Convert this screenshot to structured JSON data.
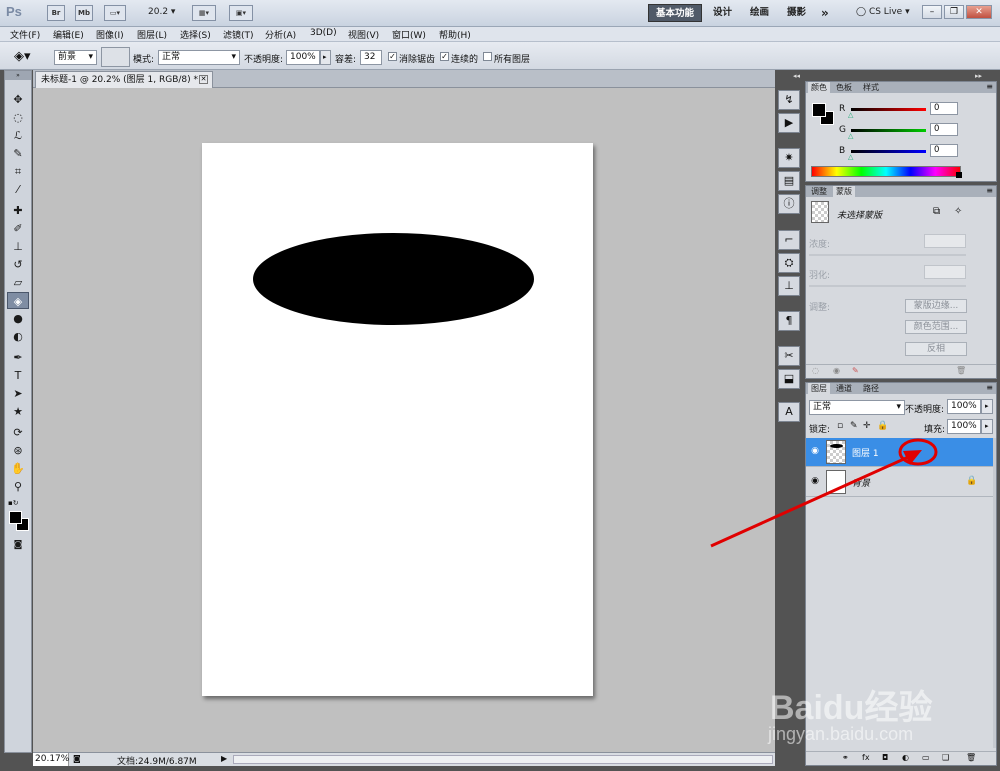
{
  "appbar": {
    "logo": "Ps",
    "bridge_label": "Br",
    "minibridge_label": "Mb",
    "zoom": "20.2",
    "workspaces": [
      "基本功能",
      "设计",
      "绘画",
      "摄影"
    ],
    "more": "»",
    "cslive": "CS Live"
  },
  "menu": [
    "文件(F)",
    "编辑(E)",
    "图像(I)",
    "图层(L)",
    "选择(S)",
    "滤镜(T)",
    "分析(A)",
    "3D(D)",
    "视图(V)",
    "窗口(W)",
    "帮助(H)"
  ],
  "options": {
    "fill_source": "前景",
    "mode_label": "模式:",
    "mode_value": "正常",
    "opacity_label": "不透明度:",
    "opacity_value": "100%",
    "tolerance_label": "容差:",
    "tolerance_value": "32",
    "antialias_label": "消除锯齿",
    "contiguous_label": "连续的",
    "all_layers_label": "所有图层"
  },
  "document": {
    "tab_title": "未标题-1 @ 20.2% (图层 1, RGB/8) *",
    "zoom_status": "20.17%",
    "doc_size": "文档:24.9M/6.87M"
  },
  "color_panel": {
    "tabs": [
      "颜色",
      "色板",
      "样式"
    ],
    "channels": [
      {
        "label": "R",
        "value": "0",
        "color": "#d00000"
      },
      {
        "label": "G",
        "value": "0",
        "color": "#00a000"
      },
      {
        "label": "B",
        "value": "0",
        "color": "#0000c8"
      }
    ]
  },
  "masks_panel": {
    "tabs": [
      "调整",
      "蒙版"
    ],
    "no_mask": "未选择蒙版",
    "density": "浓度:",
    "feather": "羽化:",
    "refine": "调整:",
    "buttons": [
      "蒙版边缘...",
      "颜色范围...",
      "反相"
    ]
  },
  "layers_panel": {
    "tabs": [
      "图层",
      "通道",
      "路径"
    ],
    "blend_mode": "正常",
    "opacity_label": "不透明度:",
    "opacity_value": "100%",
    "lock_label": "锁定:",
    "fill_label": "填充:",
    "fill_value": "100%",
    "layers": [
      {
        "name": "图层 1",
        "selected": true
      },
      {
        "name": "背景",
        "selected": false,
        "locked": true
      }
    ]
  },
  "watermark": {
    "text": "Baidu经验",
    "url": "jingyan.baidu.com"
  }
}
